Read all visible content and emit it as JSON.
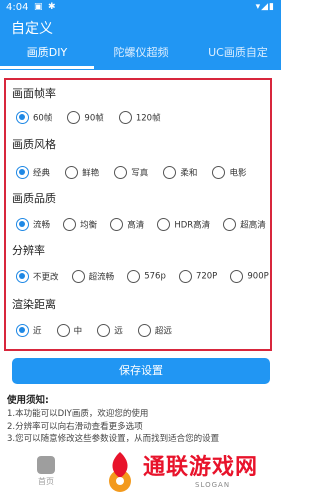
{
  "status_bar": {
    "time": "4:04",
    "icons_left": [
      "photo-icon",
      "bug-icon"
    ],
    "icons_right": [
      "wifi-icon",
      "signal-icon",
      "battery-icon"
    ]
  },
  "app_bar": {
    "title": "自定义"
  },
  "tabs": [
    {
      "label": "画质DIY",
      "active": true
    },
    {
      "label": "陀螺仪超频",
      "active": false
    },
    {
      "label": "UC画质自定",
      "active": false
    }
  ],
  "sections": {
    "frame_rate": {
      "title": "画面帧率",
      "options": [
        "60帧",
        "90帧",
        "120帧"
      ],
      "selected": "60帧"
    },
    "style": {
      "title": "画质风格",
      "options": [
        "经典",
        "鲜艳",
        "写真",
        "柔和",
        "电影"
      ],
      "selected": "经典"
    },
    "quality": {
      "title": "画质品质",
      "options": [
        "流畅",
        "均衡",
        "高清",
        "HDR高清",
        "超高清"
      ],
      "selected": "流畅"
    },
    "resolution": {
      "title": "分辨率",
      "options": [
        "不更改",
        "超流畅",
        "576p",
        "720P",
        "900P"
      ],
      "selected": "不更改"
    },
    "render_distance": {
      "title": "渲染距离",
      "options": [
        "近",
        "中",
        "远",
        "超远"
      ],
      "selected": "近"
    }
  },
  "save_button": {
    "label": "保存设置"
  },
  "instructions": {
    "title": "使用须知:",
    "lines": [
      "1.本功能可以DIY画质，欢迎您的使用",
      "2.分辨率可以向右滑动查看更多选项",
      "3.您可以随意修改这些参数设置，从而找到适合您的设置"
    ]
  },
  "bottom_nav": {
    "item_label": "首页"
  },
  "watermark": {
    "text": "通联游戏网",
    "slogan": "SLOGAN"
  },
  "colors": {
    "primary": "#2196f3",
    "highlight_border": "#d8263c",
    "radio_checked": "#1e88e5",
    "watermark_red": "#e8132b"
  }
}
